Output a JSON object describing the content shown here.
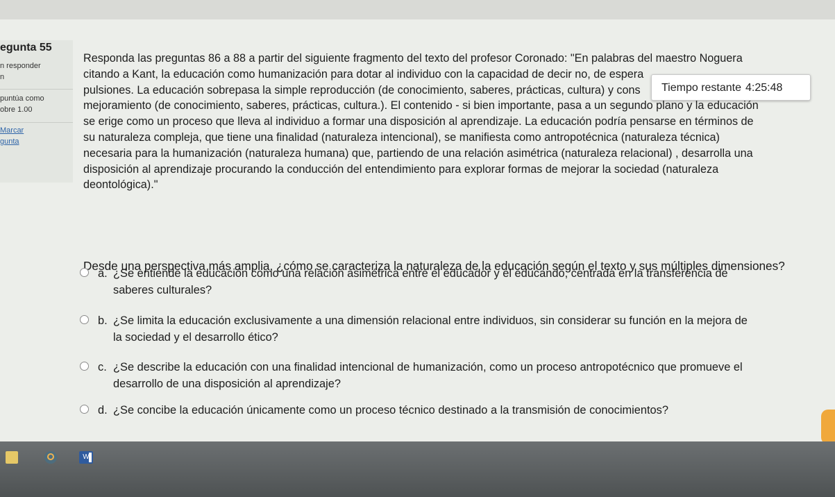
{
  "info": {
    "question_label": "egunta 55",
    "status": "n responder",
    "status_cont": "n",
    "score_label": "puntúa como",
    "score_value": "obre 1.00",
    "flag_label": "Marcar",
    "flag_cont": "gunta"
  },
  "question": {
    "lines": [
      "Responda las preguntas 86 a 88 a partir del siguiente fragmento del texto del profesor Coronado: \"En palabras del maestro Noguera",
      "citando a Kant, la educación como humanización para dotar al individuo con la capacidad de decir no, de espera",
      "pulsiones. La educación sobrepasa la simple reproducción (de conocimiento, saberes, prácticas, cultura) y cons",
      "mejoramiento (de conocimiento, saberes, prácticas, cultura.). El contenido - si bien importante, pasa a un segundo plano y la educación",
      "se erige como un proceso que lleva al individuo a formar una disposición al aprendizaje. La educación podría pensarse en términos de",
      "su naturaleza compleja, que tiene una finalidad (naturaleza intencional), se manifiesta como antropotécnica (naturaleza técnica)",
      "necesaria para la humanización (naturaleza humana) que, partiendo de una relación asimétrica (naturaleza relacional) , desarrolla una",
      "disposición al aprendizaje procurando la conducción del entendimiento para explorar formas de mejorar la sociedad (naturaleza",
      "deontológica).\""
    ],
    "prompt": "Desde una perspectiva más amplia, ¿cómo se caracteriza la naturaleza de la educación según el texto y sus múltiples dimensiones?"
  },
  "timer": {
    "label": "Tiempo restante",
    "value": "4:25:48"
  },
  "options": [
    {
      "letter": "a.",
      "line1": "¿Se entiende la educación como una relación asimétrica entre el educador y el educando, centrada en la transferencia de",
      "line2": "saberes culturales?"
    },
    {
      "letter": "b.",
      "line1": "¿Se limita la educación exclusivamente a una dimensión relacional entre individuos, sin considerar su función en la mejora de",
      "line2": "la sociedad y el desarrollo ético?"
    },
    {
      "letter": "c.",
      "line1": "¿Se describe la educación con una finalidad intencional de humanización, como un proceso antropotécnico que promueve el",
      "line2": "desarrollo de una disposición al aprendizaje?"
    },
    {
      "letter": "d.",
      "line1": "¿Se concibe la educación únicamente como un proceso técnico destinado a la transmisión de conocimientos?",
      "line2": ""
    }
  ],
  "taskbar": {
    "icons": [
      "store-icon",
      "search-icon",
      "word-icon"
    ],
    "word_letter": "W"
  }
}
